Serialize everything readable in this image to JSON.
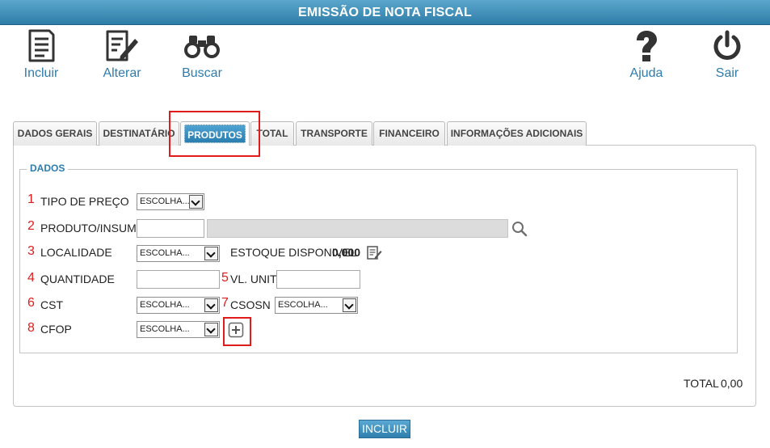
{
  "window": {
    "title": "EMISSÃO DE NOTA FISCAL"
  },
  "toolbar": {
    "incluir": {
      "label": "Incluir",
      "icon": "document-icon"
    },
    "alterar": {
      "label": "Alterar",
      "icon": "edit-document-icon"
    },
    "buscar": {
      "label": "Buscar",
      "icon": "binoculars-icon"
    },
    "ajuda": {
      "label": "Ajuda",
      "icon": "question-icon"
    },
    "sair": {
      "label": "Sair",
      "icon": "power-icon"
    }
  },
  "tabs": [
    {
      "label": "DADOS GERAIS"
    },
    {
      "label": "DESTINATÁRIO"
    },
    {
      "label": "PRODUTOS",
      "active": true
    },
    {
      "label": "TOTAL"
    },
    {
      "label": "TRANSPORTE"
    },
    {
      "label": "FINANCEIRO"
    },
    {
      "label": "INFORMAÇÕES ADICIONAIS"
    }
  ],
  "section": {
    "legend": "DADOS"
  },
  "fields": {
    "tipo_preco": {
      "number": "1",
      "label": "TIPO DE PREÇO",
      "value": "ESCOLHA..."
    },
    "produto": {
      "number": "2",
      "label": "PRODUTO/INSUMO",
      "code": "",
      "description": ""
    },
    "localidade": {
      "number": "3",
      "label": "LOCALIDADE",
      "value": "ESCOLHA...",
      "estoque_label": "ESTOQUE DISPONIVEL",
      "estoque_value": "0,000"
    },
    "quantidade": {
      "number": "4",
      "label": "QUANTIDADE",
      "value": ""
    },
    "vl_unit": {
      "number": "5",
      "label": "VL. UNIT",
      "value": ""
    },
    "cst": {
      "number": "6",
      "label": "CST",
      "value": "ESCOLHA..."
    },
    "csosn": {
      "number": "7",
      "label": "CSOSN",
      "value": "ESCOLHA..."
    },
    "cfop": {
      "number": "8",
      "label": "CFOP",
      "value": "ESCOLHA..."
    }
  },
  "total": {
    "label": "TOTAL",
    "value": "0,00"
  },
  "actions": {
    "incluir_label": "INCLUIR"
  },
  "colors": {
    "accent": "#2e7cae",
    "title_bar": "#3a8bb6",
    "highlight": "#e01b1b"
  }
}
